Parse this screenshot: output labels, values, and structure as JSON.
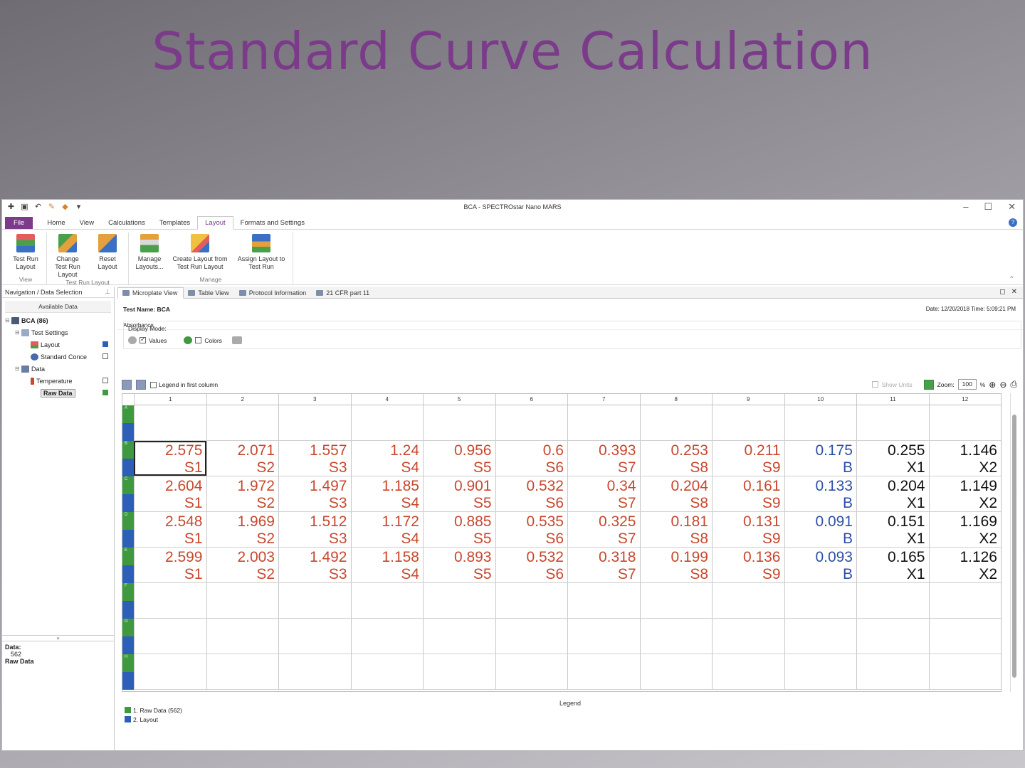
{
  "slide_title": "Standard Curve Calculation",
  "window": {
    "title": "BCA - SPECTROstar Nano MARS"
  },
  "menu": {
    "tabs": [
      "File",
      "Home",
      "View",
      "Calculations",
      "Templates",
      "Layout",
      "Formats and Settings"
    ],
    "active": "Layout"
  },
  "ribbon": {
    "groups": [
      {
        "label": "View",
        "buttons": [
          {
            "label": "Test Run Layout",
            "icon": "grid-icon"
          }
        ]
      },
      {
        "label": "Test Run Layout",
        "buttons": [
          {
            "label": "Change Test Run Layout",
            "icon": "change-layout-icon"
          },
          {
            "label": "Reset Layout",
            "icon": "reset-layout-icon"
          }
        ]
      },
      {
        "label": "Manage",
        "buttons": [
          {
            "label": "Manage Layouts...",
            "icon": "manage-layouts-icon"
          },
          {
            "label": "Create Layout from Test Run Layout",
            "icon": "create-layout-icon"
          },
          {
            "label": "Assign Layout to Test Run",
            "icon": "assign-layout-icon"
          }
        ]
      }
    ]
  },
  "nav": {
    "header": "Navigation / Data Selection",
    "available": "Available Data",
    "root": "BCA (86)",
    "test_settings": "Test Settings",
    "layout": "Layout",
    "standard": "Standard Conce",
    "data": "Data",
    "temperature": "Temperature",
    "raw": "Raw Data",
    "info_label": "Data:",
    "info_value": "562",
    "info_name": "Raw Data"
  },
  "view_tabs": [
    "Microplate View",
    "Table View",
    "Protocol Information",
    "21 CFR part 11"
  ],
  "info": {
    "test_name": "Test Name: BCA",
    "date": "Date: 12/20/2018  Time: 5:09:21 PM",
    "absorbance": "Absorbance",
    "display_mode": "Display Mode:",
    "values_label": "Values",
    "colors_label": "Colors",
    "legend_first": "Legend in first column",
    "show_units": "Show Units",
    "zoom_label": "Zoom:",
    "zoom_value": "100",
    "zoom_unit": "%"
  },
  "plate": {
    "columns": [
      "1",
      "2",
      "3",
      "4",
      "5",
      "6",
      "7",
      "8",
      "9",
      "10",
      "11",
      "12"
    ],
    "rows": [
      {
        "label": "A",
        "cells": []
      },
      {
        "label": "B",
        "cells": [
          {
            "v": "2.575",
            "id": "S1",
            "t": "std"
          },
          {
            "v": "2.071",
            "id": "S2",
            "t": "std"
          },
          {
            "v": "1.557",
            "id": "S3",
            "t": "std"
          },
          {
            "v": "1.24",
            "id": "S4",
            "t": "std"
          },
          {
            "v": "0.956",
            "id": "S5",
            "t": "std"
          },
          {
            "v": "0.6",
            "id": "S6",
            "t": "std"
          },
          {
            "v": "0.393",
            "id": "S7",
            "t": "std"
          },
          {
            "v": "0.253",
            "id": "S8",
            "t": "std"
          },
          {
            "v": "0.211",
            "id": "S9",
            "t": "std"
          },
          {
            "v": "0.175",
            "id": "B",
            "t": "blank"
          },
          {
            "v": "0.255",
            "id": "X1",
            "t": "x"
          },
          {
            "v": "1.146",
            "id": "X2",
            "t": "x"
          }
        ]
      },
      {
        "label": "C",
        "cells": [
          {
            "v": "2.604",
            "id": "S1",
            "t": "std"
          },
          {
            "v": "1.972",
            "id": "S2",
            "t": "std"
          },
          {
            "v": "1.497",
            "id": "S3",
            "t": "std"
          },
          {
            "v": "1.185",
            "id": "S4",
            "t": "std"
          },
          {
            "v": "0.901",
            "id": "S5",
            "t": "std"
          },
          {
            "v": "0.532",
            "id": "S6",
            "t": "std"
          },
          {
            "v": "0.34",
            "id": "S7",
            "t": "std"
          },
          {
            "v": "0.204",
            "id": "S8",
            "t": "std"
          },
          {
            "v": "0.161",
            "id": "S9",
            "t": "std"
          },
          {
            "v": "0.133",
            "id": "B",
            "t": "blank"
          },
          {
            "v": "0.204",
            "id": "X1",
            "t": "x"
          },
          {
            "v": "1.149",
            "id": "X2",
            "t": "x"
          }
        ]
      },
      {
        "label": "D",
        "cells": [
          {
            "v": "2.548",
            "id": "S1",
            "t": "std"
          },
          {
            "v": "1.969",
            "id": "S2",
            "t": "std"
          },
          {
            "v": "1.512",
            "id": "S3",
            "t": "std"
          },
          {
            "v": "1.172",
            "id": "S4",
            "t": "std"
          },
          {
            "v": "0.885",
            "id": "S5",
            "t": "std"
          },
          {
            "v": "0.535",
            "id": "S6",
            "t": "std"
          },
          {
            "v": "0.325",
            "id": "S7",
            "t": "std"
          },
          {
            "v": "0.181",
            "id": "S8",
            "t": "std"
          },
          {
            "v": "0.131",
            "id": "S9",
            "t": "std"
          },
          {
            "v": "0.091",
            "id": "B",
            "t": "blank"
          },
          {
            "v": "0.151",
            "id": "X1",
            "t": "x"
          },
          {
            "v": "1.169",
            "id": "X2",
            "t": "x"
          }
        ]
      },
      {
        "label": "E",
        "cells": [
          {
            "v": "2.599",
            "id": "S1",
            "t": "std"
          },
          {
            "v": "2.003",
            "id": "S2",
            "t": "std"
          },
          {
            "v": "1.492",
            "id": "S3",
            "t": "std"
          },
          {
            "v": "1.158",
            "id": "S4",
            "t": "std"
          },
          {
            "v": "0.893",
            "id": "S5",
            "t": "std"
          },
          {
            "v": "0.532",
            "id": "S6",
            "t": "std"
          },
          {
            "v": "0.318",
            "id": "S7",
            "t": "std"
          },
          {
            "v": "0.199",
            "id": "S8",
            "t": "std"
          },
          {
            "v": "0.136",
            "id": "S9",
            "t": "std"
          },
          {
            "v": "0.093",
            "id": "B",
            "t": "blank"
          },
          {
            "v": "0.165",
            "id": "X1",
            "t": "x"
          },
          {
            "v": "1.126",
            "id": "X2",
            "t": "x"
          }
        ]
      },
      {
        "label": "F",
        "cells": []
      },
      {
        "label": "G",
        "cells": []
      },
      {
        "label": "H",
        "cells": []
      }
    ]
  },
  "legend": {
    "title": "Legend",
    "items": [
      {
        "label": "1. Raw Data (562)",
        "color": "#3f9a3f"
      },
      {
        "label": "2. Layout",
        "color": "#2d5fb8"
      }
    ]
  },
  "colors": {
    "accent": "#7b3a8a",
    "standard": "#c8472d",
    "blank": "#2d4fa8",
    "raw_data": "#3f9a3f",
    "layout": "#2d5fb8"
  }
}
